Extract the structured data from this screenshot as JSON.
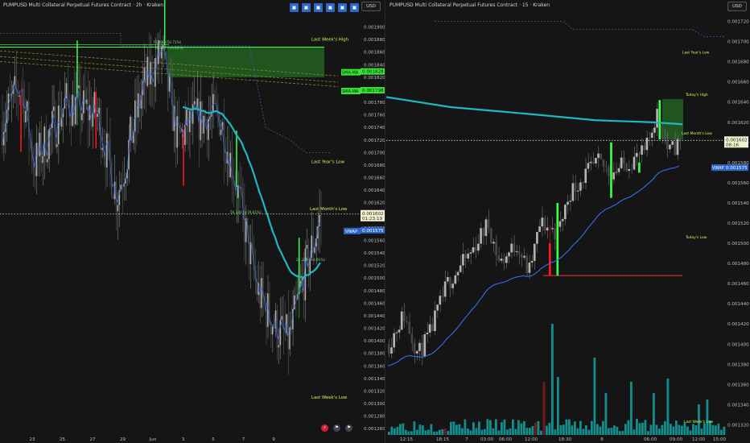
{
  "left": {
    "title": "PUMPUSD Multi Collateral Perpetual Futures Contract · 2h · Kraken",
    "currency": "USD",
    "y_ticks": [
      "0.001900",
      "0.001880",
      "0.001860",
      "0.001840",
      "0.001820",
      "0.001800",
      "0.001780",
      "0.001760",
      "0.001740",
      "0.001720",
      "0.001700",
      "0.001680",
      "0.001660",
      "0.001640",
      "0.001620",
      "0.001600",
      "0.001580",
      "0.001560",
      "0.001540",
      "0.001520",
      "0.001500",
      "0.001480",
      "0.001460",
      "0.001440",
      "0.001420",
      "0.001400",
      "0.001380",
      "0.001360",
      "0.001340",
      "0.001320",
      "0.001300",
      "0.001280",
      "0.001260"
    ],
    "x_ticks": [
      "23",
      "25",
      "27",
      "29",
      "Jun",
      "3",
      "5",
      "7",
      "9"
    ],
    "price_label": "0.001602",
    "countdown": "01:23:19",
    "vwap_label": "VWAP",
    "vwap_value": "0.001575",
    "sma1_label": "SMA-MA",
    "sma1_value": "0.001828",
    "sma2_label": "SMA-MA",
    "sma2_value": "0.001798",
    "levels": [
      "Last Week's High",
      "Last Year's Low",
      "Last Month's Low",
      "Last Week's Low"
    ],
    "annotations": [
      "76.200 (50.72%)",
      "18.766 (+0.96%)",
      "56.330 (+79.61%)",
      "24.329 (+4.91%)"
    ],
    "toolbar": [
      "▣",
      "▣",
      "▣",
      "▣",
      "▣",
      "▣"
    ]
  },
  "right": {
    "title": "PUMPUSD Multi Collateral Perpetual Futures Contract · 15 · Kraken",
    "currency": "USD",
    "y_ticks": [
      "0.001720",
      "0.001700",
      "0.001680",
      "0.001660",
      "0.001640",
      "0.001620",
      "0.001600",
      "0.001580",
      "0.001560",
      "0.001540",
      "0.001520",
      "0.001500",
      "0.001480",
      "0.001460",
      "0.001440",
      "0.001420",
      "0.001400",
      "0.001380",
      "0.001360",
      "0.001340",
      "0.001320"
    ],
    "x_ticks": [
      "12:15",
      "18:15",
      "7",
      "03:00",
      "06:00",
      "12:00",
      "18:30",
      "8",
      "06:00",
      "09:00",
      "12:00",
      "15:00"
    ],
    "price_label": "0.001602",
    "countdown": "08:16",
    "vwap_label": "VWAP",
    "vwap_value": "0.001575",
    "levels": [
      "Last Year's Low",
      "Today's High",
      "Last Month's Low",
      "Today's Low",
      "Last Week's Low"
    ]
  },
  "chart_data": [
    {
      "type": "candlestick",
      "timeframe": "2h",
      "ylim": [
        0.00125,
        0.00192
      ],
      "key_levels": {
        "Last Week's High": 0.001868,
        "Last Year's Low": 0.001683,
        "Last Month's Low": 0.001605,
        "Last Week's Low": 0.001308
      },
      "last_price": 0.001602,
      "vwap": 0.001575
    },
    {
      "type": "candlestick",
      "timeframe": "15",
      "ylim": [
        0.00131,
        0.00173
      ],
      "key_levels": {
        "Last Year's Low": 0.001688,
        "Today's High": 0.001643,
        "Last Month's Low": 0.0016,
        "Today's Low": 0.001505
      },
      "last_price": 0.001602,
      "vwap": 0.001575
    }
  ],
  "colors": {
    "up": "#b3b3b3",
    "down": "#474747",
    "big_up": "#39ff49",
    "big_down": "#ff1a1a",
    "vwap": "#3777ff",
    "ma": "#1fb7c0",
    "vol_up": "#12a3a3",
    "vol_down": "#8b1a1a"
  }
}
